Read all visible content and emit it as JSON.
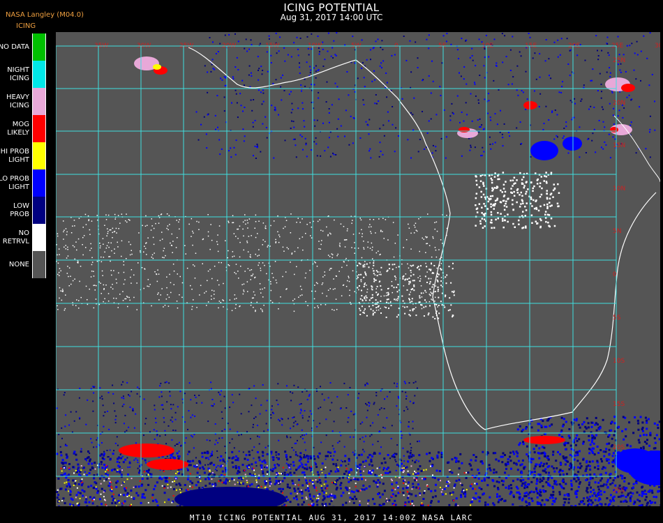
{
  "header": {
    "title": "ICING POTENTIAL",
    "subtitle": "Aug 31, 2017 14:00 UTC",
    "org": "NASA Langley (M04.0)",
    "legend_title": "ICING"
  },
  "legend": [
    {
      "label": "NO DATA",
      "color": "#00c000"
    },
    {
      "label": "NIGHT\nICING",
      "color": "#00e8e8"
    },
    {
      "label": "HEAVY\nICING",
      "color": "#e8a8d8"
    },
    {
      "label": "MOG\nLIKELY",
      "color": "#ff0000"
    },
    {
      "label": "HI PROB\nLIGHT",
      "color": "#ffff00"
    },
    {
      "label": "LO PROB\nLIGHT",
      "color": "#0000ff"
    },
    {
      "label": "LOW\nPROB",
      "color": "#000080"
    },
    {
      "label": "NO\nRETRVL",
      "color": "#ffffff"
    },
    {
      "label": "NONE",
      "color": "#555555"
    }
  ],
  "footer": "MT10   ICING POTENTIAL   AUG 31, 2017 14:00Z   NASA LARC",
  "map": {
    "background": "#555555",
    "grid_color": "#40e0e0",
    "coast_color": "#ffffff",
    "lon_labels": [
      "35W",
      "30W",
      "25W",
      "20W",
      "15W",
      "10W",
      "5W",
      "0",
      "5E",
      "10E",
      "15E",
      "20E",
      "25E",
      "30E"
    ],
    "lat_labels": [
      "30N",
      "25N",
      "20N",
      "15N",
      "10N",
      "5N",
      "0",
      "5S",
      "10S",
      "15S",
      "20S",
      "25S",
      "30S",
      "35S"
    ]
  }
}
